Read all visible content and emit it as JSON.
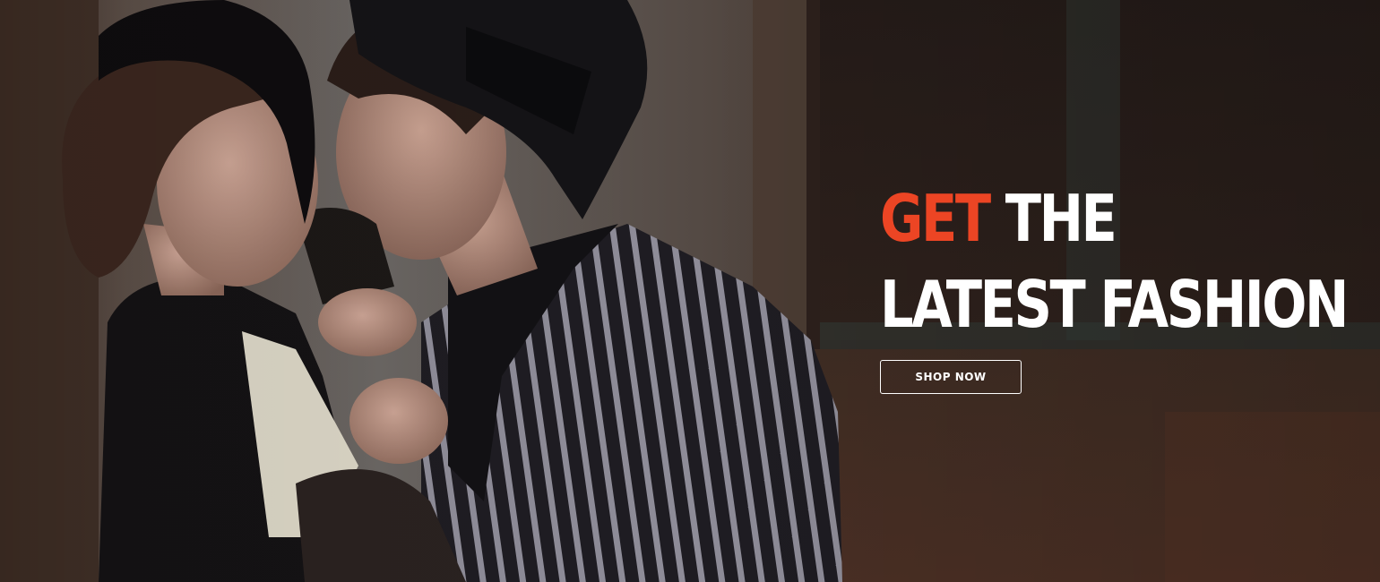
{
  "hero": {
    "headline_accent": "GET",
    "headline_rest": "THE",
    "headline_line2": "LATEST FASHION",
    "button_label": "SHOP NOW",
    "accent_color": "#ec4524",
    "text_color": "#ffffff"
  }
}
